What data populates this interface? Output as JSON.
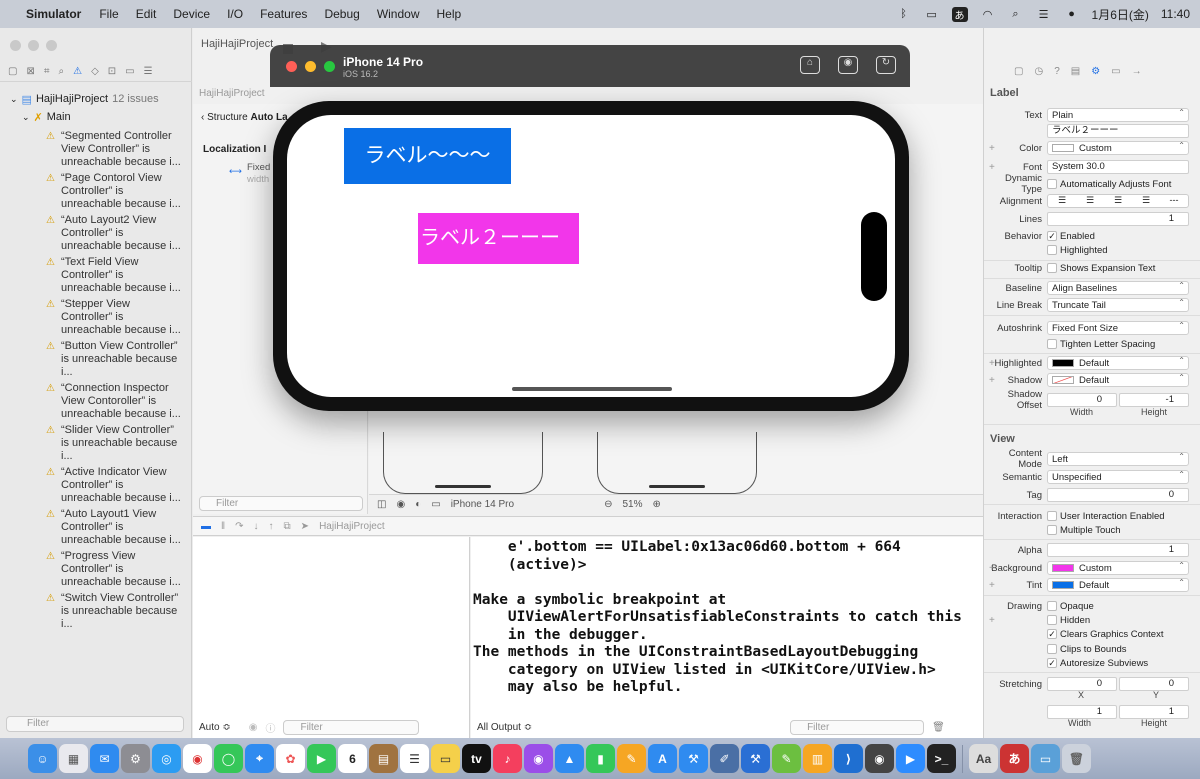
{
  "menubar": {
    "app": "Simulator",
    "items": [
      "File",
      "Edit",
      "Device",
      "I/O",
      "Features",
      "Debug",
      "Window",
      "Help"
    ],
    "input_method": "あ",
    "datetime": "1月6日(金)",
    "time": "11:40"
  },
  "xcode": {
    "project_name": "HajiHajiProject",
    "issue_count": "12 issues",
    "group": "Main",
    "issues": [
      "“Segmented Controller View Controller” is unreachable because i...",
      "“Page Contorol View Controller” is unreachable because i...",
      "“Auto Layout2 View Controller” is unreachable because i...",
      "“Text Field View Controller” is unreachable because i...",
      "“Stepper View Controller” is unreachable because i...",
      "“Button View Controller” is unreachable because i...",
      "“Connection Inspector View Contoroller” is unreachable because i...",
      "“Slider View Controller” is unreachable because i...",
      "“Active Indicator View Controller” is unreachable because i...",
      "“Auto Layout1 View Controller” is unreachable because i...",
      "“Progress View Controller” is unreachable because i...",
      "“Switch View Controller” is unreachable because i..."
    ],
    "left_filter": "Filter",
    "structure_label": "Structure",
    "structure_value": "Auto La",
    "localization": "Localization I",
    "fixed": "Fixed",
    "width": "width",
    "outline_filter": "Filter",
    "device_label": "iPhone 14 Pro",
    "zoom": "51%",
    "debug_project": "HajiHajiProject",
    "vars_mode": "Auto ≎",
    "vars_filter": "Filter",
    "output_mode": "All Output ≎",
    "console_filter": "Filter",
    "console_text": "    e'.bottom == UILabel:0x13ac06d60.bottom + 664\n    (active)>\n\nMake a symbolic breakpoint at\n    UIViewAlertForUnsatisfiableConstraints to catch this\n    in the debugger.\nThe methods in the UIConstraintBasedLayoutDebugging\n    category on UIView listed in <UIKitCore/UIView.h>\n    may also be helpful."
  },
  "simulator": {
    "device": "iPhone 14 Pro",
    "os": "iOS 16.2",
    "label1": "ラベル〜〜〜",
    "label2": "ラベル２ーーー"
  },
  "inspector": {
    "label_section": "Label",
    "text_label": "Text",
    "text_value": "Plain",
    "text_content": "ラベル２ーーー",
    "color_label": "Color",
    "color_value": "Custom",
    "font_label": "Font",
    "font_value": "System 30.0",
    "dyntype_label": "Dynamic Type",
    "dyntype_value": "Automatically Adjusts Font",
    "alignment_label": "Alignment",
    "lines_label": "Lines",
    "lines_value": "1",
    "behavior_label": "Behavior",
    "enabled": "Enabled",
    "highlighted": "Highlighted",
    "tooltip_label": "Tooltip",
    "tooltip_value": "Shows Expansion Text",
    "baseline_label": "Baseline",
    "baseline_value": "Align Baselines",
    "linebreak_label": "Line Break",
    "linebreak_value": "Truncate Tail",
    "autoshrink_label": "Autoshrink",
    "autoshrink_value": "Fixed Font Size",
    "tighten": "Tighten Letter Spacing",
    "highlighted_label": "Highlighted",
    "highlighted_value": "Default",
    "shadow_label": "Shadow",
    "shadow_value": "Default",
    "shadow_offset_label": "Shadow Offset",
    "shadow_w": "0",
    "shadow_h": "-1",
    "width_sub": "Width",
    "height_sub": "Height",
    "view_section": "View",
    "content_mode_label": "Content Mode",
    "content_mode_value": "Left",
    "semantic_label": "Semantic",
    "semantic_value": "Unspecified",
    "tag_label": "Tag",
    "tag_value": "0",
    "interaction_label": "Interaction",
    "user_interaction": "User Interaction Enabled",
    "multiple_touch": "Multiple Touch",
    "alpha_label": "Alpha",
    "alpha_value": "1",
    "background_label": "Background",
    "background_value": "Custom",
    "tint_label": "Tint",
    "tint_value": "Default",
    "drawing_label": "Drawing",
    "opaque": "Opaque",
    "hidden": "Hidden",
    "clears": "Clears Graphics Context",
    "clips": "Clips to Bounds",
    "autoresize": "Autoresize Subviews",
    "stretching_label": "Stretching",
    "stretch_x": "0",
    "stretch_y": "0",
    "x_sub": "X",
    "y_sub": "Y",
    "stretch_w": "1",
    "stretch_h": "1"
  },
  "colors": {
    "label1_bg": "#0a6fe6",
    "label2_bg": "#f236ea",
    "accent": "#1f6fe5"
  }
}
